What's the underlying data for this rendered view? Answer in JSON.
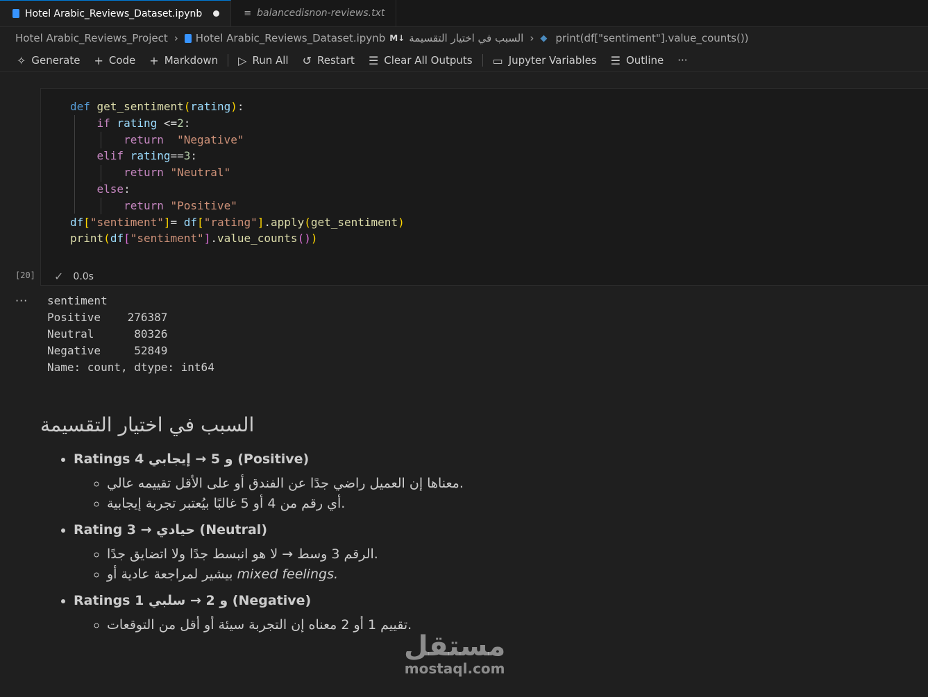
{
  "tabs": [
    {
      "label": "Hotel Arabic_Reviews_Dataset.ipynb",
      "modified": true
    },
    {
      "label": "balancedisnon-reviews.txt"
    }
  ],
  "breadcrumb": {
    "project": "Hotel Arabic_Reviews_Project",
    "notebook": "Hotel Arabic_Reviews_Dataset.ipynb",
    "md_badge": "M↓",
    "section": "السبب في اختيار التقسيمة",
    "cell": "print(df[\"sentiment\"].value_counts())"
  },
  "toolbar": {
    "generate": "Generate",
    "code": "Code",
    "markdown": "Markdown",
    "run_all": "Run All",
    "restart": "Restart",
    "clear_outputs": "Clear All Outputs",
    "variables": "Jupyter Variables",
    "outline": "Outline",
    "more": "···"
  },
  "cell": {
    "exec_count": "[20]",
    "duration": "0.0s",
    "output_more": "···",
    "output": "sentiment\nPositive    276387\nNeutral      80326\nNegative     52849\nName: count, dtype: int64"
  },
  "markdown": {
    "heading": "السبب في اختيار التقسيمة",
    "items": [
      {
        "title": "Ratings 4 و 5 → إيجابي (Positive)",
        "subs": [
          "معناها إن العميل راضي جدًا عن الفندق أو على الأقل تقييمه عالي.",
          "أي رقم من 4 أو 5 غالبًا بيُعتبر تجربة إيجابية."
        ]
      },
      {
        "title": "Rating 3 → حيادي (Neutral)",
        "subs": [
          "الرقم 3 وسط → لا هو انبسط جدًا ولا اتضايق جدًا.",
          "بيشير لمراجعة عادية أو"
        ],
        "em": "mixed feelings."
      },
      {
        "title": "Ratings 1 و 2 → سلبي (Negative)",
        "subs": [
          "تقييم 1 أو 2 معناه إن التجربة سيئة أو أقل من التوقعات."
        ]
      }
    ]
  },
  "watermark": {
    "arabic": "مستقل",
    "latin": "mostaql.com"
  }
}
